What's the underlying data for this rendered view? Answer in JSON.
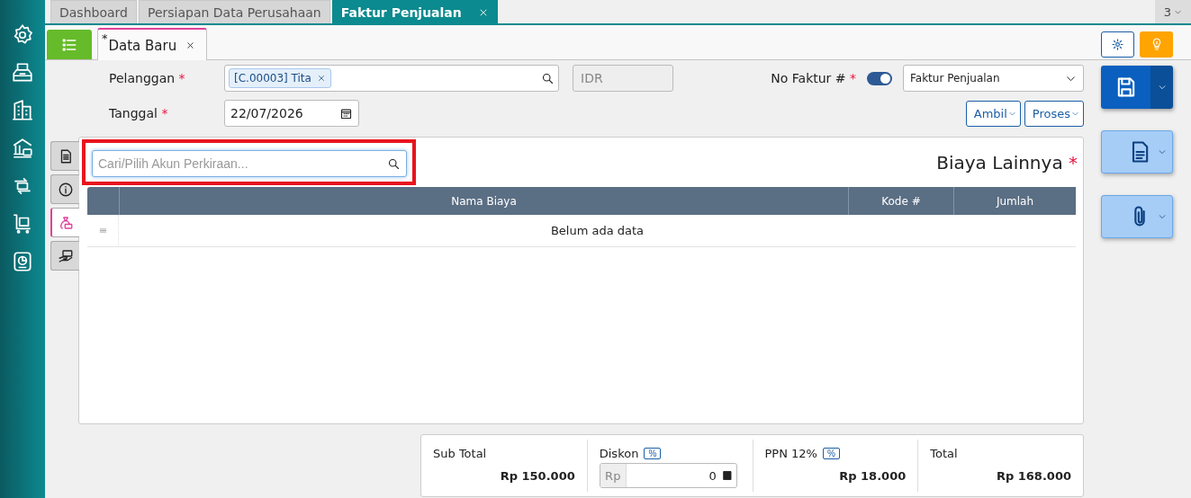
{
  "top_tabs": [
    {
      "label": "Dashboard",
      "selected": false
    },
    {
      "label": "Persiapan Data Perusahaan",
      "selected": false
    },
    {
      "label": "Faktur Penjualan",
      "selected": true
    }
  ],
  "tab_overflow": "3",
  "doc_tab": {
    "modified_mark": "*",
    "label": "Data Baru",
    "selected": true
  },
  "form": {
    "customer_label": "Pelanggan",
    "customer_required": "*",
    "customer_tag": "[C.00003] Tita",
    "currency": "IDR",
    "invoice_label": "No Faktur #",
    "invoice_required": "*",
    "auto_number": {
      "on": true
    },
    "invoice_type": "Faktur Penjualan",
    "date_label": "Tanggal",
    "date_required": "*",
    "date": "22/07/2026"
  },
  "actions": [
    "Ambil",
    "Proses"
  ],
  "side_tabs": [
    {
      "kind": "document",
      "selected": false
    },
    {
      "kind": "info",
      "selected": false
    },
    {
      "kind": "costs",
      "selected": true
    },
    {
      "kind": "payment",
      "selected": false
    }
  ],
  "panel": {
    "search": {
      "placeholder": "Cari/Pilih Akun Perkiraan...",
      "highlighted": true
    },
    "title": "Biaya Lainnya",
    "title_required": "*",
    "table": {
      "columns": [
        "Nama Biaya",
        "Kode #",
        "Jumlah"
      ],
      "empty_text": "Belum ada data"
    }
  },
  "summary": {
    "subtotal_label": "Sub Total",
    "subtotal": "Rp 150.000",
    "discount_label": "Diskon",
    "discount_unit": "%",
    "discount_prefix": "Rp",
    "discount_value": "0",
    "tax_label": "PPN 12%",
    "tax_unit": "%",
    "tax": "Rp 18.000",
    "total_label": "Total",
    "total": "Rp 168.000"
  }
}
